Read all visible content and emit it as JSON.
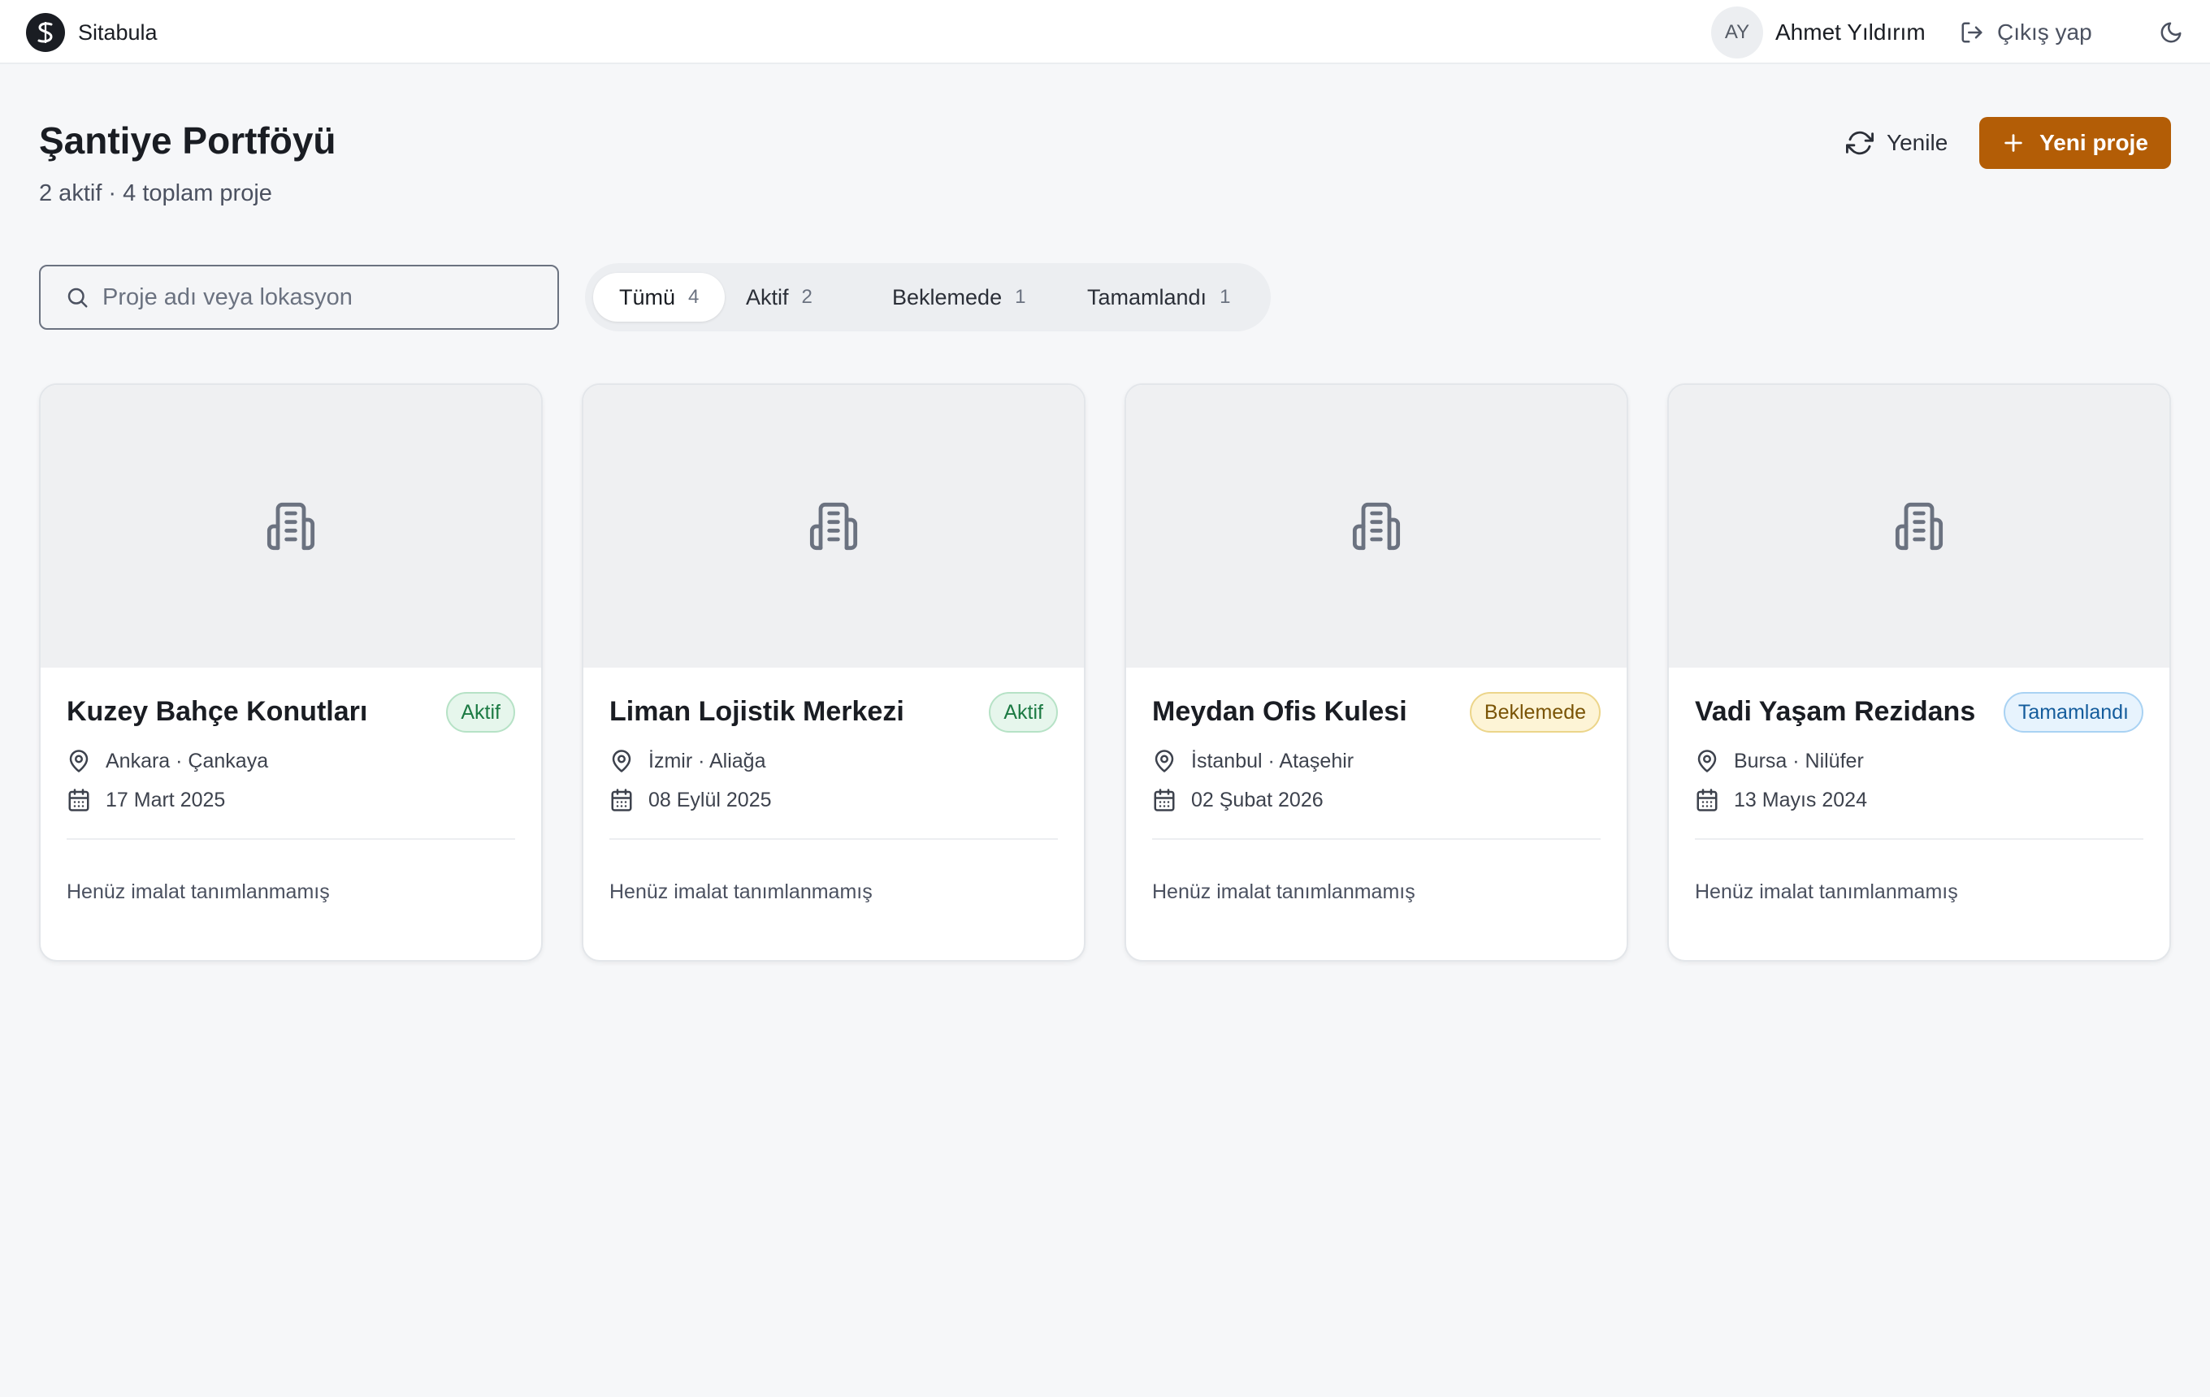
{
  "app": {
    "name": "Sitabula"
  },
  "user": {
    "initials": "AY",
    "name": "Ahmet Yıldırım",
    "logout_label": "Çıkış yap"
  },
  "header": {
    "title": "Şantiye Portföyü",
    "subtitle": "2 aktif · 4 toplam proje",
    "refresh_label": "Yenile",
    "new_project_label": "Yeni proje"
  },
  "search": {
    "placeholder": "Proje adı veya lokasyon",
    "value": ""
  },
  "filters": [
    {
      "label": "Tümü",
      "count": "4",
      "selected": true
    },
    {
      "label": "Aktif",
      "count": "2",
      "selected": false
    },
    {
      "label": "Beklemede",
      "count": "1",
      "selected": false
    },
    {
      "label": "Tamamlandı",
      "count": "1",
      "selected": false
    }
  ],
  "projects": [
    {
      "name": "Kuzey Bahçe Konutları",
      "status": "Aktif",
      "location": "Ankara · Çankaya",
      "date": "17 Mart 2025",
      "note": "Henüz imalat tanımlanmamış"
    },
    {
      "name": "Liman Lojistik Merkezi",
      "status": "Aktif",
      "location": "İzmir · Aliağa",
      "date": "08 Eylül 2025",
      "note": "Henüz imalat tanımlanmamış"
    },
    {
      "name": "Meydan Ofis Kulesi",
      "status": "Beklemede",
      "location": "İstanbul · Ataşehir",
      "date": "02 Şubat 2026",
      "note": "Henüz imalat tanımlanmamış"
    },
    {
      "name": "Vadi Yaşam Rezidans",
      "status": "Tamamlandı",
      "location": "Bursa · Nilüfer",
      "date": "13 Mayıs 2024",
      "note": "Henüz imalat tanımlanmamış"
    }
  ],
  "colors": {
    "accent": "#b35d06",
    "status_active": "#1c7a43",
    "status_pending": "#7a5406",
    "status_done": "#145c9c"
  },
  "icons": {
    "logo": "sitabula-logo-icon",
    "logout": "logout-icon",
    "theme": "moon-icon",
    "refresh": "refresh-icon",
    "add": "plus-icon",
    "search": "search-icon",
    "project_placeholder": "building-icon",
    "location": "map-pin-icon",
    "date": "calendar-icon"
  }
}
